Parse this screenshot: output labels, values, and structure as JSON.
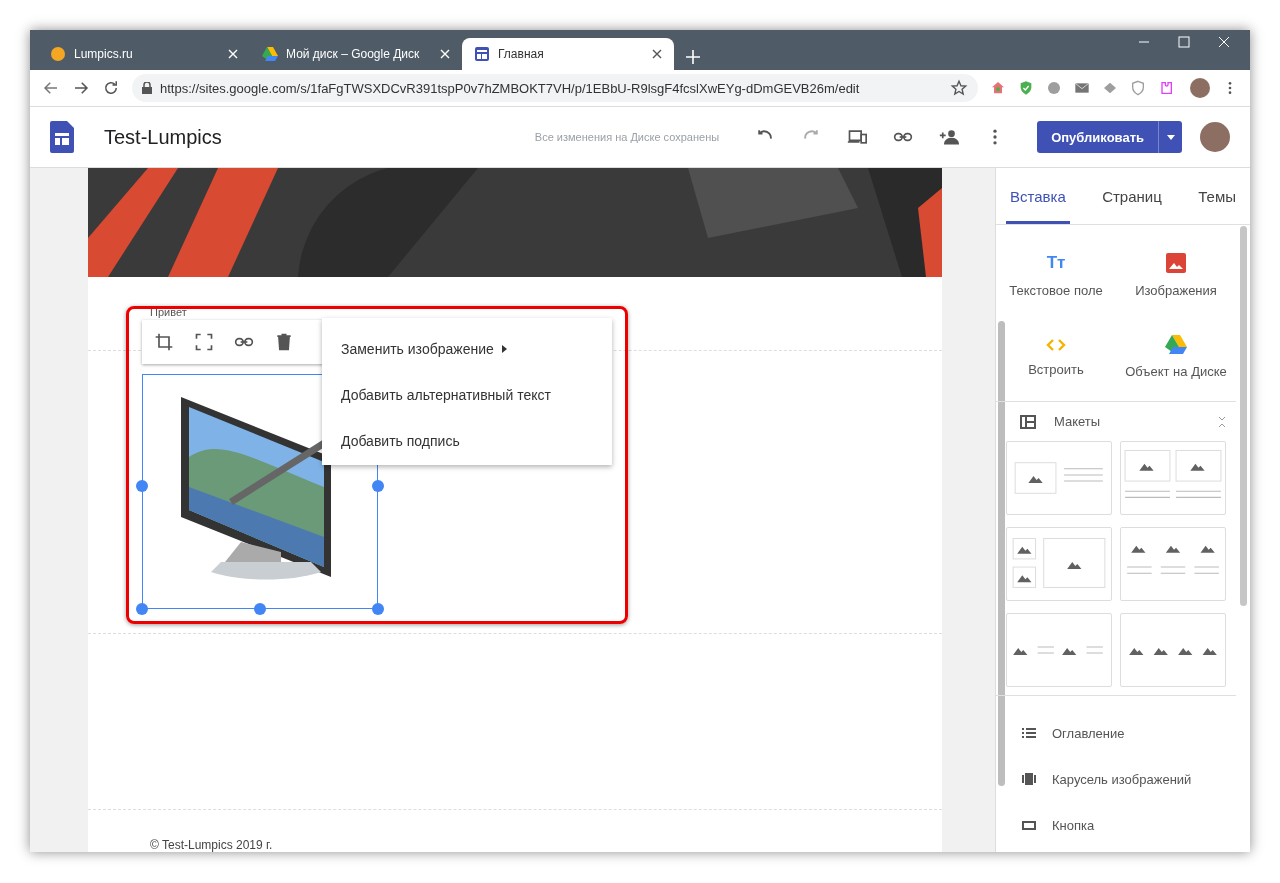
{
  "browser": {
    "tabs": [
      {
        "title": "Lumpics.ru",
        "kind": "orange",
        "selected": false
      },
      {
        "title": "Мой диск – Google Диск",
        "kind": "drive",
        "selected": false
      },
      {
        "title": "Главная",
        "kind": "sites",
        "selected": true
      }
    ],
    "url": "https://sites.google.com/s/1faFgTWSXDCvR391tspP0v7hZMBOKT7VH/p/1EBbU-R9lsgF4fcslXwEYg-dDmGEVB26m/edit"
  },
  "header": {
    "title": "Test-Lumpics",
    "save_status": "Все изменения на Диске сохранены",
    "publish_button": "Опубликовать"
  },
  "canvas": {
    "greeting": "Привет",
    "context_menu": [
      {
        "label": "Заменить изображение",
        "submenu": true
      },
      {
        "label": "Добавить альтернативный текст",
        "submenu": false
      },
      {
        "label": "Добавить подпись",
        "submenu": false
      }
    ],
    "footer": "© Test-Lumpics 2019 г."
  },
  "panel": {
    "tabs": [
      {
        "label": "Вставка",
        "selected": true
      },
      {
        "label": "Страниц",
        "selected": false
      },
      {
        "label": "Темы",
        "selected": false
      }
    ],
    "insert_items": [
      {
        "label": "Текстовое поле",
        "kind": "text",
        "glyph": "Tт"
      },
      {
        "label": "Изображения",
        "kind": "image"
      },
      {
        "label": "Встроить",
        "kind": "embed"
      },
      {
        "label": "Объект на Диске",
        "kind": "drive"
      }
    ],
    "layouts_label": "Макеты",
    "layouts": [
      {
        "kind": "image-text"
      },
      {
        "kind": "two-images"
      },
      {
        "kind": "small-large"
      },
      {
        "kind": "three-images"
      },
      {
        "kind": "two-image-text"
      },
      {
        "kind": "four-images"
      }
    ],
    "components": [
      {
        "label": "Оглавление",
        "kind": "toc"
      },
      {
        "label": "Карусель изображений",
        "kind": "carousel"
      },
      {
        "label": "Кнопка",
        "kind": "button"
      }
    ]
  }
}
